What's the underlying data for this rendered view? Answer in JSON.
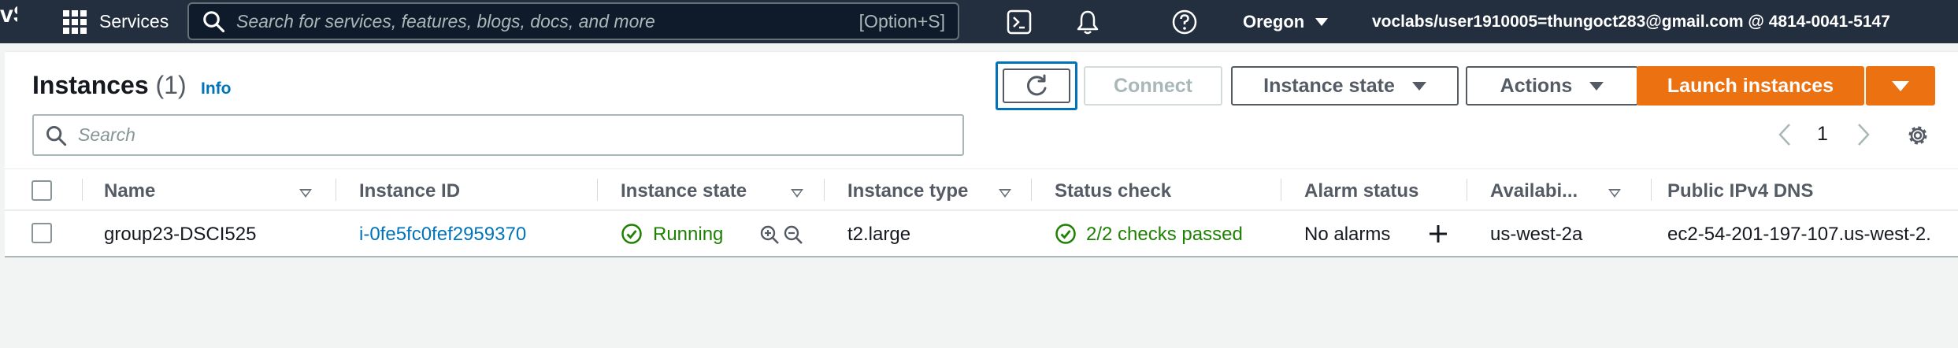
{
  "topnav": {
    "logo": "vS",
    "services_label": "Services",
    "search_placeholder": "Search for services, features, blogs, docs, and more",
    "search_shortcut": "[Option+S]",
    "region": "Oregon",
    "account": "voclabs/user1910005=thungoct283@gmail.com @ 4814-0041-5147"
  },
  "header": {
    "title": "Instances",
    "count": "(1)",
    "info": "Info",
    "connect_label": "Connect",
    "instance_state_label": "Instance state",
    "actions_label": "Actions",
    "launch_label": "Launch instances"
  },
  "filter": {
    "placeholder": "Search"
  },
  "pagination": {
    "page": "1"
  },
  "table": {
    "columns": [
      "Name",
      "Instance ID",
      "Instance state",
      "Instance type",
      "Status check",
      "Alarm status",
      "Availabi...",
      "Public IPv4 DNS"
    ],
    "rows": [
      {
        "name": "group23-DSCI525",
        "instance_id": "i-0fe5fc0fef2959370",
        "state": "Running",
        "type": "t2.large",
        "status_check": "2/2 checks passed",
        "alarm": "No alarms",
        "az": "us-west-2a",
        "dns": "ec2-54-201-197-107.us-west-2."
      }
    ]
  },
  "colors": {
    "nav_bg": "#232f3e",
    "link": "#0073bb",
    "primary": "#ec7211",
    "success": "#1d8102"
  }
}
